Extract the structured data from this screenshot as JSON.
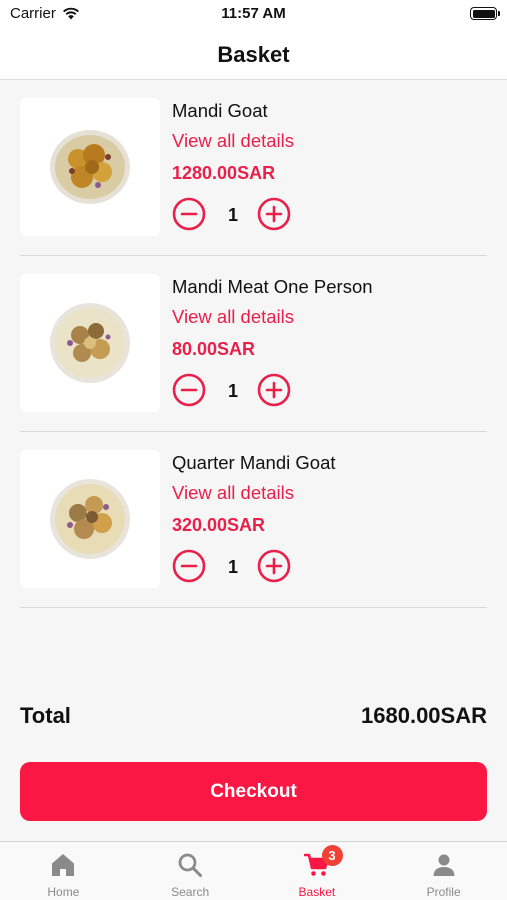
{
  "status_bar": {
    "carrier": "Carrier",
    "time": "11:57 AM"
  },
  "header": {
    "title": "Basket"
  },
  "basket": {
    "items": [
      {
        "name": "Mandi Goat",
        "details_label": "View all details",
        "price": "1280.00SAR",
        "quantity": "1"
      },
      {
        "name": "Mandi Meat One Person",
        "details_label": "View all details",
        "price": "80.00SAR",
        "quantity": "1"
      },
      {
        "name": "Quarter Mandi Goat",
        "details_label": "View all details",
        "price": "320.00SAR",
        "quantity": "1"
      }
    ],
    "total_label": "Total",
    "total_value": "1680.00SAR",
    "checkout_label": "Checkout"
  },
  "tabbar": {
    "tabs": [
      {
        "label": "Home",
        "icon": "home-icon"
      },
      {
        "label": "Search",
        "icon": "search-icon"
      },
      {
        "label": "Basket",
        "icon": "cart-icon",
        "badge": "3"
      },
      {
        "label": "Profile",
        "icon": "person-icon"
      }
    ]
  },
  "colors": {
    "accent": "#fb1744",
    "badge": "#ef4136",
    "inactive": "#8a8a8a"
  }
}
